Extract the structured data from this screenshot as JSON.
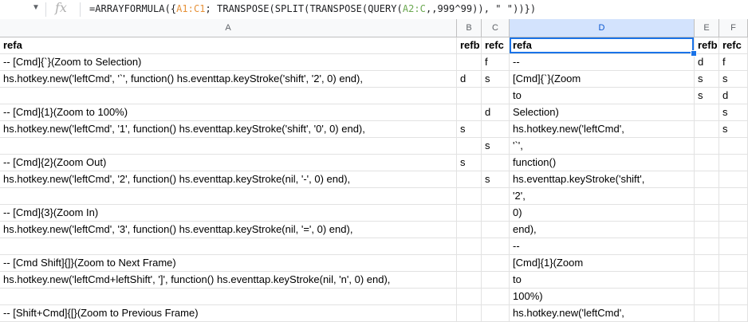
{
  "formula_bar": {
    "fx_label": "fx",
    "formula_prefix": "=ARRAYFORMULA({",
    "ref1": "A1:C1",
    "formula_mid": "; TRANSPOSE(SPLIT(TRANSPOSE(QUERY(",
    "ref2": "A2:C",
    "formula_suffix": ",,999^99)), \" \"))})"
  },
  "columns": [
    "A",
    "B",
    "C",
    "D",
    "E",
    "F"
  ],
  "selected_column": "D",
  "rows": [
    [
      "refa",
      "refb",
      "refc",
      "refa",
      "refb",
      "refc"
    ],
    [
      "-- [Cmd]{`}(Zoom to Selection)",
      "",
      "f",
      "--",
      "d",
      "f"
    ],
    [
      "hs.hotkey.new('leftCmd', '`', function() hs.eventtap.keyStroke('shift', '2', 0) end),",
      "d",
      "s",
      "[Cmd]{`}(Zoom",
      "s",
      "s"
    ],
    [
      "",
      "",
      "",
      "to",
      "s",
      "d"
    ],
    [
      "-- [Cmd]{1}(Zoom to 100%)",
      "",
      "d",
      "Selection)",
      "",
      "s"
    ],
    [
      "hs.hotkey.new('leftCmd', '1', function() hs.eventtap.keyStroke('shift', '0', 0) end),",
      "s",
      "",
      "hs.hotkey.new('leftCmd',",
      "",
      "s"
    ],
    [
      "",
      "",
      "s",
      "'`',",
      "",
      ""
    ],
    [
      "-- [Cmd]{2}(Zoom Out)",
      "s",
      "",
      "function()",
      "",
      ""
    ],
    [
      "hs.hotkey.new('leftCmd', '2', function() hs.eventtap.keyStroke(nil, '-', 0) end),",
      "",
      "s",
      "hs.eventtap.keyStroke('shift',",
      "",
      ""
    ],
    [
      "",
      "",
      "",
      "'2',",
      "",
      ""
    ],
    [
      "-- [Cmd]{3}(Zoom In)",
      "",
      "",
      "0)",
      "",
      ""
    ],
    [
      "hs.hotkey.new('leftCmd', '3', function() hs.eventtap.keyStroke(nil, '=', 0) end),",
      "",
      "",
      "end),",
      "",
      ""
    ],
    [
      "",
      "",
      "",
      "--",
      "",
      ""
    ],
    [
      "-- [Cmd Shift]{]}(Zoom to Next Frame)",
      "",
      "",
      "[Cmd]{1}(Zoom",
      "",
      ""
    ],
    [
      "hs.hotkey.new('leftCmd+leftShift', ']', function() hs.eventtap.keyStroke(nil, 'n', 0) end),",
      "",
      "",
      "to",
      "",
      ""
    ],
    [
      "",
      "",
      "",
      "100%)",
      "",
      ""
    ],
    [
      "-- [Shift+Cmd]{[}(Zoom to Previous Frame)",
      "",
      "",
      "hs.hotkey.new('leftCmd',",
      "",
      ""
    ]
  ],
  "colors": {
    "selection": "#1a73e8",
    "header_bg": "#f8f9fa",
    "selected_header_bg": "#d3e3fd",
    "range_ref1": "#e69138",
    "range_ref2": "#6aa84f"
  }
}
